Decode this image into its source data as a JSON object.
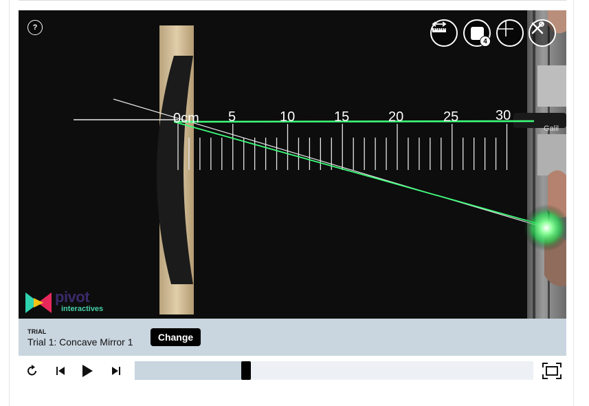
{
  "viewer": {
    "help_label": "?",
    "tools": [
      {
        "name": "ruler-tool-icon"
      },
      {
        "name": "frame-marker-icon",
        "badge": "4"
      },
      {
        "name": "crosshair-icon"
      },
      {
        "name": "tools-icon"
      }
    ],
    "ruler": {
      "labels": [
        "0cm",
        "5",
        "10",
        "15",
        "20",
        "25",
        "30"
      ],
      "extra_text": "Galil"
    },
    "logo": {
      "word": "pivot",
      "sub": "interactives"
    }
  },
  "trial": {
    "label": "TRIAL",
    "name": "Trial 1: Concave Mirror 1",
    "change_label": "Change"
  },
  "playback": {
    "progress": 0.279
  },
  "colors": {
    "trial_bar": "#c9d5df",
    "laser": "#3dff7a",
    "scrub_track": "#edf1f5"
  }
}
